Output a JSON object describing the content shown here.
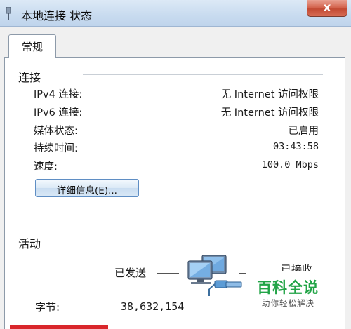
{
  "window": {
    "title": "本地连接 状态",
    "close_glyph": "x"
  },
  "tabs": [
    {
      "label": "常规"
    }
  ],
  "connection": {
    "section_title": "连接",
    "rows": [
      {
        "label": "IPv4 连接:",
        "value": "无 Internet 访问权限"
      },
      {
        "label": "IPv6 连接:",
        "value": "无 Internet 访问权限"
      },
      {
        "label": "媒体状态:",
        "value": "已启用"
      },
      {
        "label": "持续时间:",
        "value": "03:43:58"
      },
      {
        "label": "速度:",
        "value": "100.0 Mbps"
      }
    ],
    "details_button": "详细信息(E)..."
  },
  "activity": {
    "section_title": "活动",
    "sent_label": "已发送",
    "received_label": "已接收",
    "bytes_label": "字节:",
    "bytes_sent": "38,632,154",
    "icon": "network-computers-icon"
  },
  "watermark": {
    "main": "百科全说",
    "sub": "助你轻松解决"
  },
  "colors": {
    "close_button": "#d46650",
    "accent_bar": "#d9262b",
    "watermark": "#22a447"
  }
}
